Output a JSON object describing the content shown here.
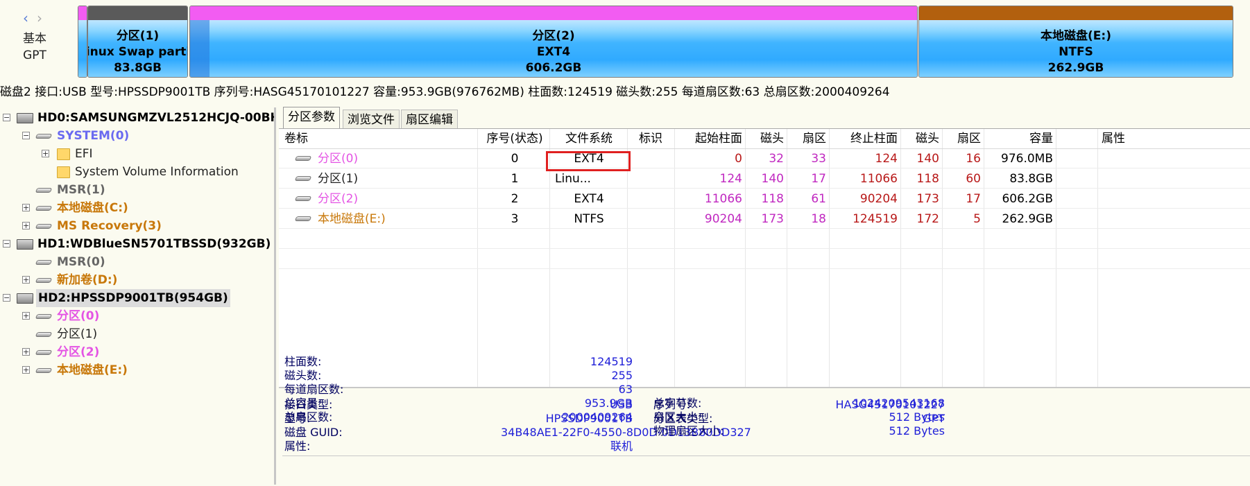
{
  "nav": {
    "back": "‹",
    "forward": "›"
  },
  "disk_type": {
    "line1": "基本",
    "line2": "GPT"
  },
  "segments": [
    {
      "name": "分区(1)",
      "fs": "Linux Swap partition",
      "size": "83.8GB"
    },
    {
      "name": "分区(2)",
      "fs": "EXT4",
      "size": "606.2GB"
    },
    {
      "name": "本地磁盘(E:)",
      "fs": "NTFS",
      "size": "262.9GB"
    }
  ],
  "disk_info": "磁盘2 接口:USB  型号:HPSSDP9001TB  序列号:HASG45170101227  容量:953.9GB(976762MB)  柱面数:124519  磁头数:255  每道扇区数:63  总扇区数:2000409264",
  "tree": {
    "hd0": "HD0:SAMSUNGMZVL2512HCJQ-00BH",
    "system": "SYSTEM(0)",
    "efi": "EFI",
    "svi": "System Volume Information",
    "msr1": "MSR(1)",
    "c": "本地磁盘(C:)",
    "msrec": "MS Recovery(3)",
    "hd1": "HD1:WDBlueSN5701TBSSD(932GB)",
    "msr0": "MSR(0)",
    "d": "新加卷(D:)",
    "hd2": "HD2:HPSSDP9001TB(954GB)",
    "p0": "分区(0)",
    "p1": "分区(1)",
    "p2": "分区(2)",
    "e": "本地磁盘(E:)"
  },
  "tabs": [
    "分区参数",
    "浏览文件",
    "扇区编辑"
  ],
  "columns": [
    "卷标",
    "序号(状态)",
    "文件系统",
    "标识",
    "起始柱面",
    "磁头",
    "扇区",
    "终止柱面",
    "磁头",
    "扇区",
    "容量",
    "属性"
  ],
  "rows": [
    {
      "label": "分区(0)",
      "index": "0",
      "fs": "EXT4",
      "id": "",
      "start_cyl": "0",
      "start_head": "32",
      "start_sec": "33",
      "end_cyl": "124",
      "end_head": "140",
      "end_sec": "16",
      "capacity": "976.0MB",
      "attr": ""
    },
    {
      "label": "分区(1)",
      "index": "1",
      "fs": "Linu...",
      "id": "",
      "start_cyl": "124",
      "start_head": "140",
      "start_sec": "17",
      "end_cyl": "11066",
      "end_head": "118",
      "end_sec": "60",
      "capacity": "83.8GB",
      "attr": ""
    },
    {
      "label": "分区(2)",
      "index": "2",
      "fs": "EXT4",
      "id": "",
      "start_cyl": "11066",
      "start_head": "118",
      "start_sec": "61",
      "end_cyl": "90204",
      "end_head": "173",
      "end_sec": "17",
      "capacity": "606.2GB",
      "attr": ""
    },
    {
      "label": "本地磁盘(E:)",
      "index": "3",
      "fs": "NTFS",
      "id": "",
      "start_cyl": "90204",
      "start_head": "173",
      "start_sec": "18",
      "end_cyl": "124519",
      "end_head": "172",
      "end_sec": "5",
      "capacity": "262.9GB",
      "attr": ""
    }
  ],
  "details": {
    "iface_label": "接口类型:",
    "iface": "USB",
    "serial_label": "序列号:",
    "serial": "HASG45170101227",
    "model_label": "型号:",
    "model": "HPSSDP9001TB",
    "ptype_label": "分区表类型:",
    "ptype": "GPT",
    "guid_label": "磁盘 GUID:",
    "guid": "34B48AE1-22F0-4550-8D0D-0D13B80DD327",
    "attr_label": "属性:",
    "attr": "联机",
    "cyl_label": "柱面数:",
    "cyl": "124519",
    "heads_label": "磁头数:",
    "heads": "255",
    "spt_label": "每道扇区数:",
    "spt": "63",
    "cap_label": "总容量:",
    "cap": "953.9GB",
    "bytes_label": "总字节数:",
    "bytes": "1024209543168",
    "sectors_label": "总扇区数:",
    "sectors": "2000409264",
    "secsize_label": "扇区大小:",
    "secsize": "512 Bytes",
    "physsec_label": "物理扇区大小:",
    "physsec": "512 Bytes"
  },
  "colors": {
    "seg_small_cap": "#5a5a5a",
    "seg_mid_cap": "#f25cf2",
    "seg_right_cap": "#b2600e",
    "highlight_box": "#e02020"
  }
}
